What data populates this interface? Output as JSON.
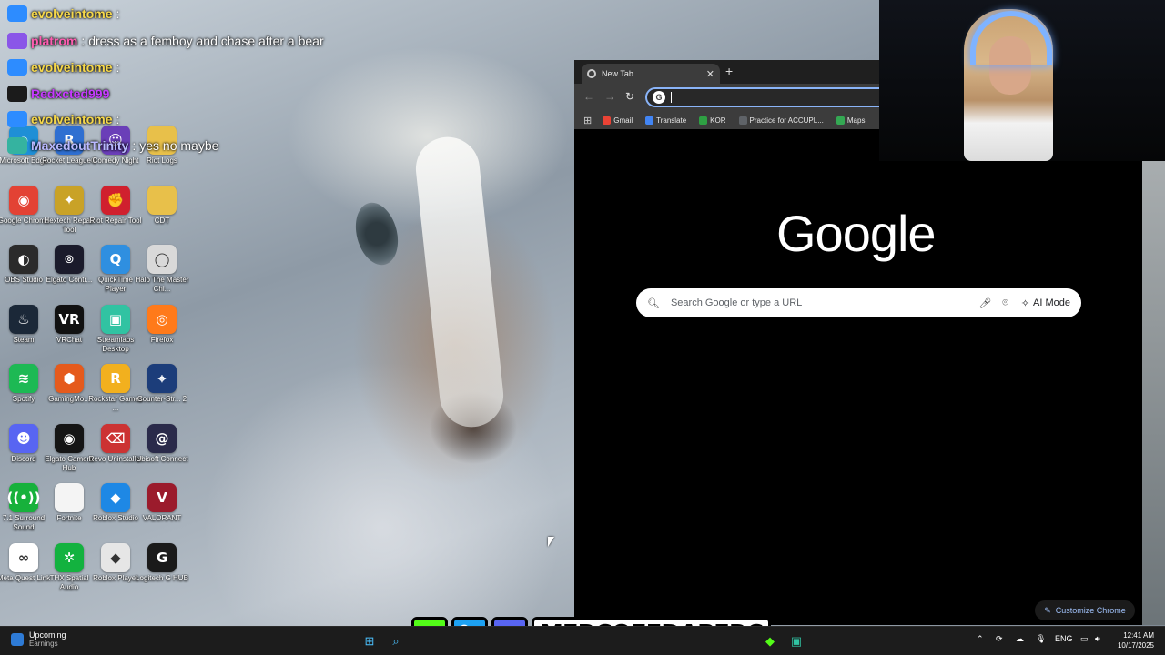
{
  "chat": [
    {
      "user": "evolveintome",
      "sep": ":",
      "text": "",
      "color": "#f5d74a"
    },
    {
      "user": "platrom",
      "sep": ":",
      "text": "dress as a femboy and chase after a bear",
      "color": "#ff5db1"
    },
    {
      "user": "evolveintome",
      "sep": ":",
      "text": "",
      "color": "#f5d74a"
    },
    {
      "user": "Redxcted999",
      "sep": "",
      "text": "",
      "color": "#c63bff"
    },
    {
      "user": "evolveintome",
      "sep": ":",
      "text": "",
      "color": "#f5d74a"
    },
    {
      "user": "MaxedoutTrinity",
      "sep": ":",
      "text": "yes no maybe",
      "color": "#b9b9ff"
    }
  ],
  "desktop_icons": [
    {
      "label": "Microsoft Edge",
      "icon": "edge-icon",
      "color": "#1f8fd6",
      "glyph": "e"
    },
    {
      "label": "Rocket League®",
      "icon": "rocket-league-icon",
      "color": "#2f6fd1",
      "glyph": "R"
    },
    {
      "label": "Comedy Night",
      "icon": "comedy-night-icon",
      "color": "#6a3fb8",
      "glyph": "☺"
    },
    {
      "label": "Riot Logs",
      "icon": "folder-icon",
      "color": "#e8c04a",
      "glyph": ""
    },
    {
      "label": "Google Chrome",
      "icon": "chrome-icon",
      "color": "#e34234",
      "glyph": "◉"
    },
    {
      "label": "Hextech Repair Tool",
      "icon": "hextech-icon",
      "color": "#c9a227",
      "glyph": "✦"
    },
    {
      "label": "Riot Repair Tool",
      "icon": "riot-icon",
      "color": "#d0202e",
      "glyph": "✊"
    },
    {
      "label": "CDT",
      "icon": "folder-icon",
      "color": "#e8c04a",
      "glyph": ""
    },
    {
      "label": "OBS Studio",
      "icon": "obs-icon",
      "color": "#2b2b2b",
      "glyph": "◐"
    },
    {
      "label": "Elgato Contr...",
      "icon": "elgato-icon",
      "color": "#1b1b2b",
      "glyph": "⌾"
    },
    {
      "label": "QuickTime Player",
      "icon": "quicktime-icon",
      "color": "#2f8fe0",
      "glyph": "Q"
    },
    {
      "label": "Halo The Master Chi...",
      "icon": "halo-icon",
      "color": "#d9d9d9",
      "glyph": "◯"
    },
    {
      "label": "Steam",
      "icon": "steam-icon",
      "color": "#1b2838",
      "glyph": "♨"
    },
    {
      "label": "VRChat",
      "icon": "vrchat-icon",
      "color": "#111111",
      "glyph": "VR"
    },
    {
      "label": "Streamlabs Desktop",
      "icon": "streamlabs-icon",
      "color": "#31c3a2",
      "glyph": "▣"
    },
    {
      "label": "Firefox",
      "icon": "firefox-icon",
      "color": "#ff7a1a",
      "glyph": "◎"
    },
    {
      "label": "Spotify",
      "icon": "spotify-icon",
      "color": "#1db954",
      "glyph": "≋"
    },
    {
      "label": "GamingMo...",
      "icon": "gaming-mode-icon",
      "color": "#e55a1c",
      "glyph": "⬢"
    },
    {
      "label": "Rockstar Games ...",
      "icon": "rockstar-icon",
      "color": "#f2b01e",
      "glyph": "R"
    },
    {
      "label": "Counter-Str... 2",
      "icon": "counter-strike-icon",
      "color": "#1c3d7a",
      "glyph": "⌖"
    },
    {
      "label": "Discord",
      "icon": "discord-icon",
      "color": "#5865f2",
      "glyph": "☻"
    },
    {
      "label": "Elgato Camera Hub",
      "icon": "camera-hub-icon",
      "color": "#151515",
      "glyph": "◉"
    },
    {
      "label": "Revo Uninstaller",
      "icon": "revo-icon",
      "color": "#cc3333",
      "glyph": "⌫"
    },
    {
      "label": "Ubisoft Connect",
      "icon": "ubisoft-icon",
      "color": "#2a2a4a",
      "glyph": "@"
    },
    {
      "label": "7.1 Surround Sound",
      "icon": "surround-icon",
      "color": "#17b13b",
      "glyph": "((•))"
    },
    {
      "label": "Fortnite",
      "icon": "file-icon",
      "color": "#f4f4f4",
      "glyph": ""
    },
    {
      "label": "Roblox Studio",
      "icon": "roblox-studio-icon",
      "color": "#1e88e5",
      "glyph": "◆"
    },
    {
      "label": "VALORANT",
      "icon": "valorant-icon",
      "color": "#9b1b2c",
      "glyph": "V"
    },
    {
      "label": "Meta Quest Link",
      "icon": "meta-icon",
      "color": "#ffffff",
      "glyph": "∞"
    },
    {
      "label": "THX Spatial Audio",
      "icon": "thx-icon",
      "color": "#13b23f",
      "glyph": "✲"
    },
    {
      "label": "Roblox Player",
      "icon": "roblox-icon",
      "color": "#e6e6e6",
      "glyph": "◆"
    },
    {
      "label": "Logitech G HUB",
      "icon": "logitech-icon",
      "color": "#1a1a1a",
      "glyph": "G"
    }
  ],
  "browser": {
    "tab_title": "New Tab",
    "new_tab": "+",
    "omnibox_value": "",
    "bookmarks": [
      {
        "label": "Gmail",
        "icon": "gmail-icon",
        "color": "#ea4335"
      },
      {
        "label": "Translate",
        "icon": "translate-icon",
        "color": "#4285f4"
      },
      {
        "label": "KOR",
        "icon": "kor-icon",
        "color": "#2ea043"
      },
      {
        "label": "Practice for ACCUPL...",
        "icon": "page-icon",
        "color": "#5f6368"
      },
      {
        "label": "Maps",
        "icon": "maps-icon",
        "color": "#34a853"
      }
    ],
    "logo": "Google",
    "search_placeholder": "Search Google or type a URL",
    "ai_mode": "AI Mode",
    "customize": "Customize Chrome"
  },
  "social": {
    "handle": "MERCOFFDAPERC",
    "kick": "K"
  },
  "taskbar": {
    "weather_title": "Upcoming",
    "weather_sub": "Earnings",
    "language": "ENG",
    "time": "12:41 AM",
    "date": "10/17/2025"
  }
}
